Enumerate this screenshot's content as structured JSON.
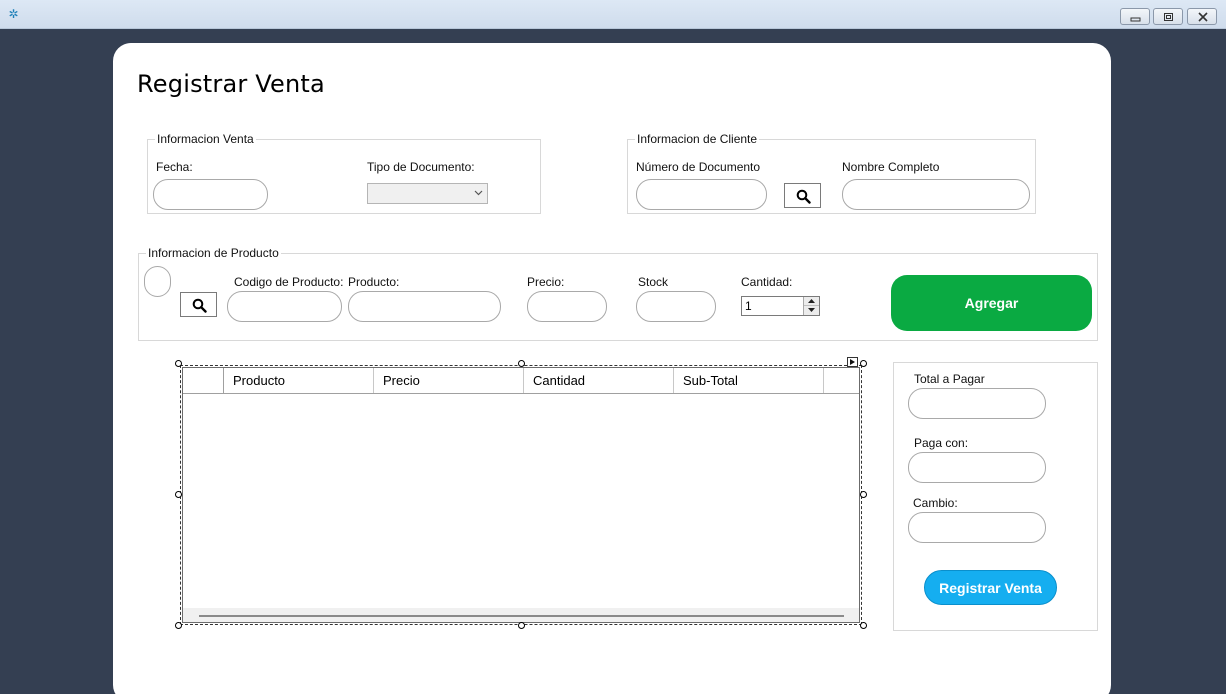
{
  "window": {
    "icon": "app-gear-icon",
    "controls": [
      "minimize-icon",
      "maximize-icon",
      "close-icon"
    ]
  },
  "page": {
    "title": "Registrar Venta"
  },
  "venta": {
    "legend": "Informacion Venta",
    "fecha_label": "Fecha:",
    "fecha_value": "",
    "tipo_doc_label": "Tipo de Documento:",
    "tipo_doc_value": ""
  },
  "cliente": {
    "legend": "Informacion de Cliente",
    "num_doc_label": "Número de Documento",
    "num_doc_value": "",
    "nombre_label": "Nombre Completo",
    "nombre_value": ""
  },
  "producto": {
    "legend": "Informacion de Producto",
    "codigo_label": "Codigo de Producto:",
    "producto_label": "Producto:",
    "precio_label": "Precio:",
    "stock_label": "Stock",
    "cantidad_label": "Cantidad:",
    "cantidad_value": "1",
    "agregar_label": "Agregar"
  },
  "grid": {
    "columns": [
      "Producto",
      "Precio",
      "Cantidad",
      "Sub-Total"
    ]
  },
  "totales": {
    "total_label": "Total a Pagar",
    "paga_con_label": "Paga con:",
    "cambio_label": "Cambio:",
    "registrar_label": "Registrar Venta"
  },
  "colors": {
    "frame_bg": "#343f52",
    "agregar_green": "#0aaa42",
    "registrar_blue": "#15aef0"
  }
}
